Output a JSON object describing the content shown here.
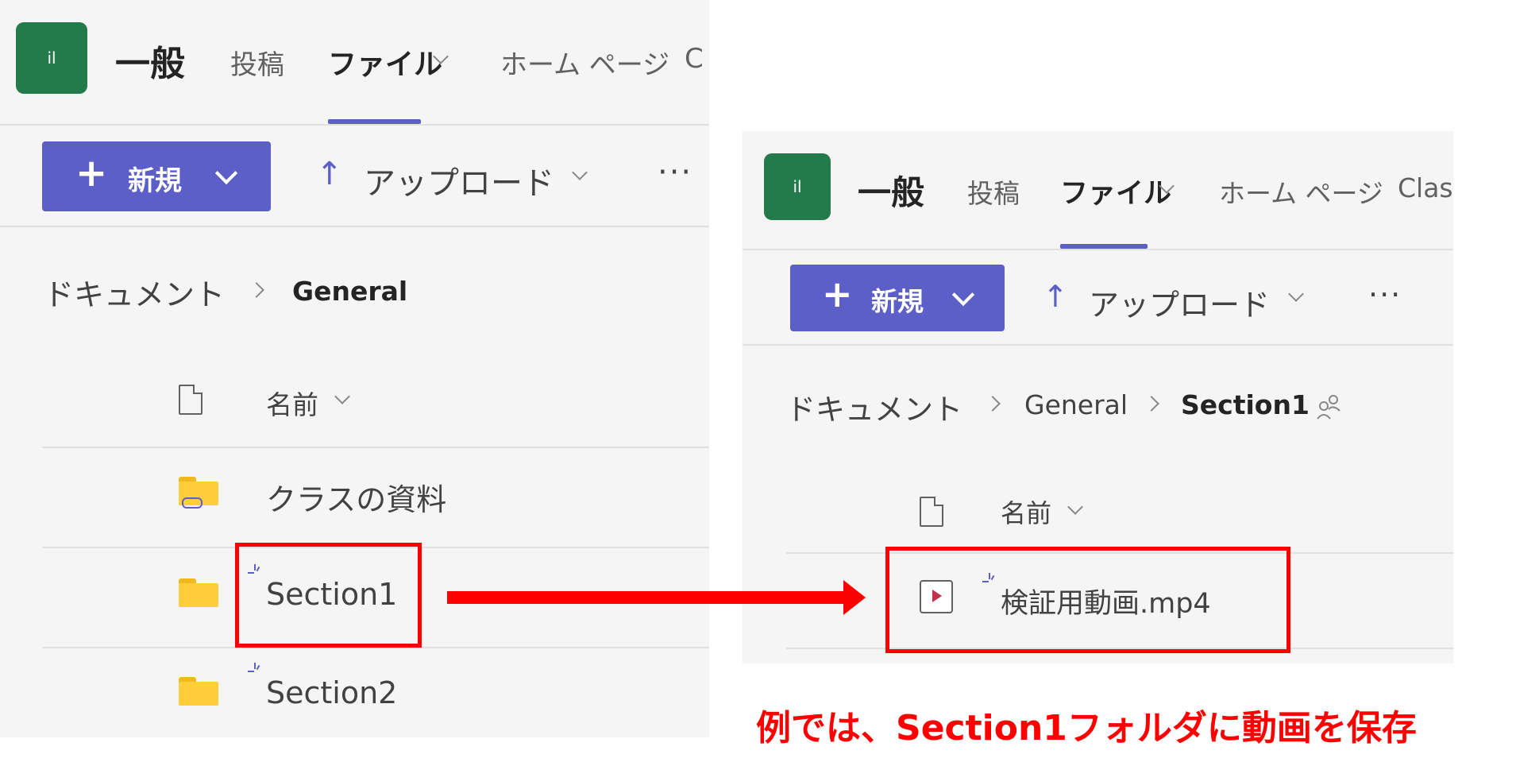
{
  "left": {
    "app_icon": "il",
    "channel": "一般",
    "tabs": [
      "投稿",
      "ファイル",
      "ホーム ページ",
      "C"
    ],
    "new_label": "新規",
    "upload_label": "アップロード",
    "more": "···",
    "breadcrumb": [
      "ドキュメント",
      "General"
    ],
    "column_name": "名前",
    "rows": [
      "クラスの資料",
      "Section1",
      "Section2"
    ]
  },
  "right": {
    "app_icon": "il",
    "channel": "一般",
    "tabs": [
      "投稿",
      "ファイル",
      "ホーム ページ",
      "Class"
    ],
    "new_label": "新規",
    "upload_label": "アップロード",
    "more": "···",
    "breadcrumb": [
      "ドキュメント",
      "General",
      "Section1"
    ],
    "column_name": "名前",
    "rows": [
      "検証用動画.mp4"
    ]
  },
  "caption": "例では、Section1フォルダに動画を保存",
  "colors": {
    "accent": "#5b5fc7",
    "annotation": "#ff0000",
    "app_icon": "#237b4b"
  }
}
